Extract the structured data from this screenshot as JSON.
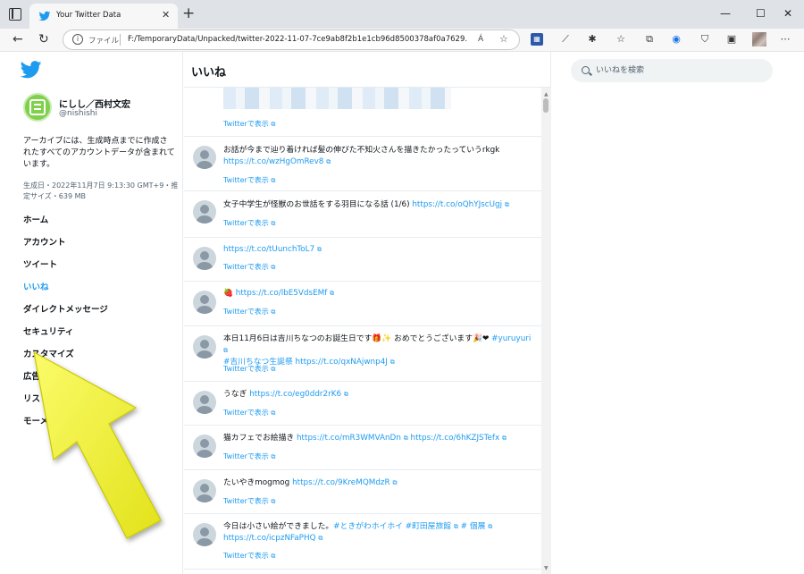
{
  "browser": {
    "tab_title": "Your Twitter Data",
    "tab_close": "✕",
    "new_tab": "+",
    "url_scheme": "ファイル",
    "url": "F:/TemporaryData/Unpacked/twitter-2022-11-07-7ce9ab8f2b1e1cb96d8500378af0a7629...",
    "reader_icon": "Á",
    "window_controls": [
      "—",
      "☐",
      "✕"
    ]
  },
  "profile": {
    "display_name": "にしし／西村文宏",
    "handle": "@nishishi"
  },
  "archive": {
    "description": "アーカイブには、生成時点までに作成されたすべてのアカウントデータが含まれています。",
    "meta": "生成日・2022年11月7日 9:13:30 GMT+9・推定サイズ・639 MB"
  },
  "menu": [
    {
      "label": "ホーム"
    },
    {
      "label": "アカウント"
    },
    {
      "label": "ツイート"
    },
    {
      "label": "いいね",
      "active": true
    },
    {
      "label": "ダイレクトメッセージ"
    },
    {
      "label": "セキュリティ"
    },
    {
      "label": "カスタマイズ"
    },
    {
      "label": "広告"
    },
    {
      "label": "リスト"
    },
    {
      "label": "モーメント"
    }
  ],
  "main": {
    "title": "いいね",
    "view_on_twitter": "Twitterで表示",
    "tweets": [
      {
        "text": "",
        "links": []
      },
      {
        "text": "お話が今まで辿り着ければ髪の伸びた不知火さんを描きたかったっていうrkgk",
        "links": [
          "https://t.co/wzHgOmRev8"
        ]
      },
      {
        "text": "女子中学生が怪獣のお世話をする羽目になる話 (1/6)",
        "links": [
          "https://t.co/oQhYJscUgj"
        ]
      },
      {
        "text": "",
        "links": [
          "https://t.co/tUunchToL7"
        ]
      },
      {
        "text": "🍓",
        "links": [
          "https://t.co/lbE5VdsEMf"
        ]
      },
      {
        "text": "本日11月6日は吉川ちなつのお誕生日です🎁✨ おめでとうございます🎉❤",
        "links": [
          "#yuruyuri",
          "#吉川ちなつ生誕祭",
          "https://t.co/qxNAjwnp4J"
        ]
      },
      {
        "text": "うなぎ",
        "links": [
          "https://t.co/eg0ddr2rK6"
        ]
      },
      {
        "text": "猫カフェでお絵描き",
        "links": [
          "https://t.co/mR3WMVAnDn",
          "https://t.co/6hKZJSTefx"
        ]
      },
      {
        "text": "たいやきmogmog",
        "links": [
          "https://t.co/9KreMQMdzR"
        ]
      },
      {
        "text": "今日は小さい絵ができました。",
        "links": [
          "#ときがわホイホイ",
          "#町田屋旅館",
          "# 個展",
          "https://t.co/icpzNFaPHQ"
        ]
      }
    ]
  },
  "search": {
    "placeholder": "いいねを検索"
  },
  "colors": {
    "accent": "#1d9bf0",
    "arrow": "#f2f23a"
  }
}
